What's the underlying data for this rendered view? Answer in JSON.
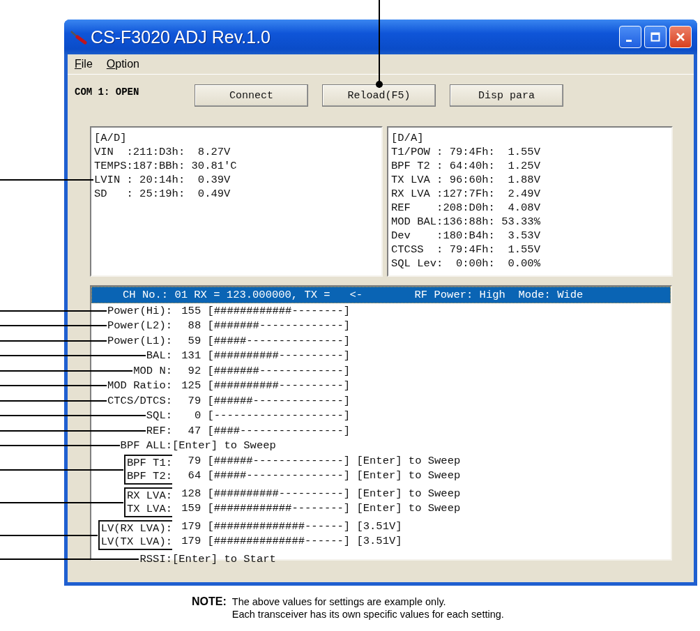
{
  "window": {
    "title": "CS-F3020 ADJ Rev.1.0"
  },
  "menu": [
    {
      "label": "File"
    },
    {
      "label": "Option"
    }
  ],
  "port_status": "COM 1: OPEN",
  "buttons": [
    {
      "label": "Connect",
      "callout": false
    },
    {
      "label": "Reload(F5)",
      "callout": true
    },
    {
      "label": "Disp para",
      "callout": false
    }
  ],
  "ad_panel": {
    "heading": "[A/D]",
    "lines": [
      {
        "text": "VIN  :211:D3h:  8.27V",
        "callout": false
      },
      {
        "text": "TEMPS:187:BBh: 30.81'C",
        "callout": false
      },
      {
        "text": "LVIN : 20:14h:  0.39V",
        "callout": true
      },
      {
        "text": "SD   : 25:19h:  0.49V",
        "callout": false
      }
    ]
  },
  "da_panel": {
    "heading": "[D/A]",
    "lines": [
      {
        "text": "T1/POW : 79:4Fh:  1.55V",
        "callout": false
      },
      {
        "text": "BPF T2 : 64:40h:  1.25V",
        "callout": false
      },
      {
        "text": "TX LVA : 96:60h:  1.88V",
        "callout": false
      },
      {
        "text": "RX LVA :127:7Fh:  2.49V",
        "callout": false
      },
      {
        "text": "REF    :208:D0h:  4.08V",
        "callout": false
      },
      {
        "text": "MOD BAL:136:88h: 53.33%",
        "callout": false
      },
      {
        "text": "Dev    :180:B4h:  3.53V",
        "callout": false
      },
      {
        "text": "CTCSS  : 79:4Fh:  1.55V",
        "callout": false
      },
      {
        "text": "SQL Lev:  0:00h:  0.00%",
        "callout": false
      }
    ]
  },
  "channel_list": {
    "header": {
      "text": "CH No.: 01 RX = 123.000000, TX =   <-        RF Power: High  Mode: Wide",
      "selected": true
    },
    "items": [
      {
        "kind": "row",
        "callout": true,
        "label": "Power(Hi):",
        "value": "155",
        "bar": "[############--------]"
      },
      {
        "kind": "row",
        "callout": true,
        "label": "Power(L2):",
        "value": "88",
        "bar": "[#######-------------]"
      },
      {
        "kind": "row",
        "callout": true,
        "label": "Power(L1):",
        "value": "59",
        "bar": "[#####---------------]"
      },
      {
        "kind": "row",
        "callout": true,
        "label": "BAL:",
        "value": "131",
        "bar": "[##########----------]"
      },
      {
        "kind": "row",
        "callout": true,
        "label": "MOD N:",
        "value": "92",
        "bar": "[#######-------------]"
      },
      {
        "kind": "row",
        "callout": true,
        "label": "MOD Ratio:",
        "value": "125",
        "bar": "[##########----------]"
      },
      {
        "kind": "row",
        "callout": true,
        "label": "CTCS/DTCS:",
        "value": "79",
        "bar": "[######--------------]"
      },
      {
        "kind": "row",
        "callout": true,
        "label": "SQL:",
        "value": "0",
        "bar": "[--------------------]"
      },
      {
        "kind": "row",
        "callout": true,
        "label": "REF:",
        "value": "47",
        "bar": "[####----------------]"
      },
      {
        "kind": "row",
        "callout": true,
        "label": "BPF ALL:",
        "action": "[Enter] to Sweep"
      },
      {
        "kind": "group",
        "callout": true,
        "rows": [
          {
            "label": "BPF T1:",
            "value": "79",
            "bar": "[######--------------]",
            "action": "[Enter] to Sweep"
          },
          {
            "label": "BPF T2:",
            "value": "64",
            "bar": "[#####---------------]",
            "action": "[Enter] to Sweep"
          }
        ]
      },
      {
        "kind": "group",
        "callout": true,
        "rows": [
          {
            "label": "RX LVA:",
            "value": "128",
            "bar": "[##########----------]",
            "action": "[Enter] to Sweep"
          },
          {
            "label": "TX LVA:",
            "value": "159",
            "bar": "[############--------]",
            "action": "[Enter] to Sweep"
          }
        ]
      },
      {
        "kind": "group",
        "callout": true,
        "rows": [
          {
            "label": "LV(RX LVA):",
            "value": "179",
            "bar": "[##############------]",
            "action": "[3.51V]"
          },
          {
            "label": "LV(TX LVA):",
            "value": "179",
            "bar": "[##############------]",
            "action": "[3.51V]"
          }
        ]
      },
      {
        "kind": "row",
        "callout": true,
        "label": "RSSI:",
        "action": "[Enter] to Start"
      }
    ]
  },
  "note": {
    "label": "NOTE:",
    "lines": [
      "The above values for settings are example only.",
      "Each transceiver has its own specific values for each setting."
    ]
  }
}
